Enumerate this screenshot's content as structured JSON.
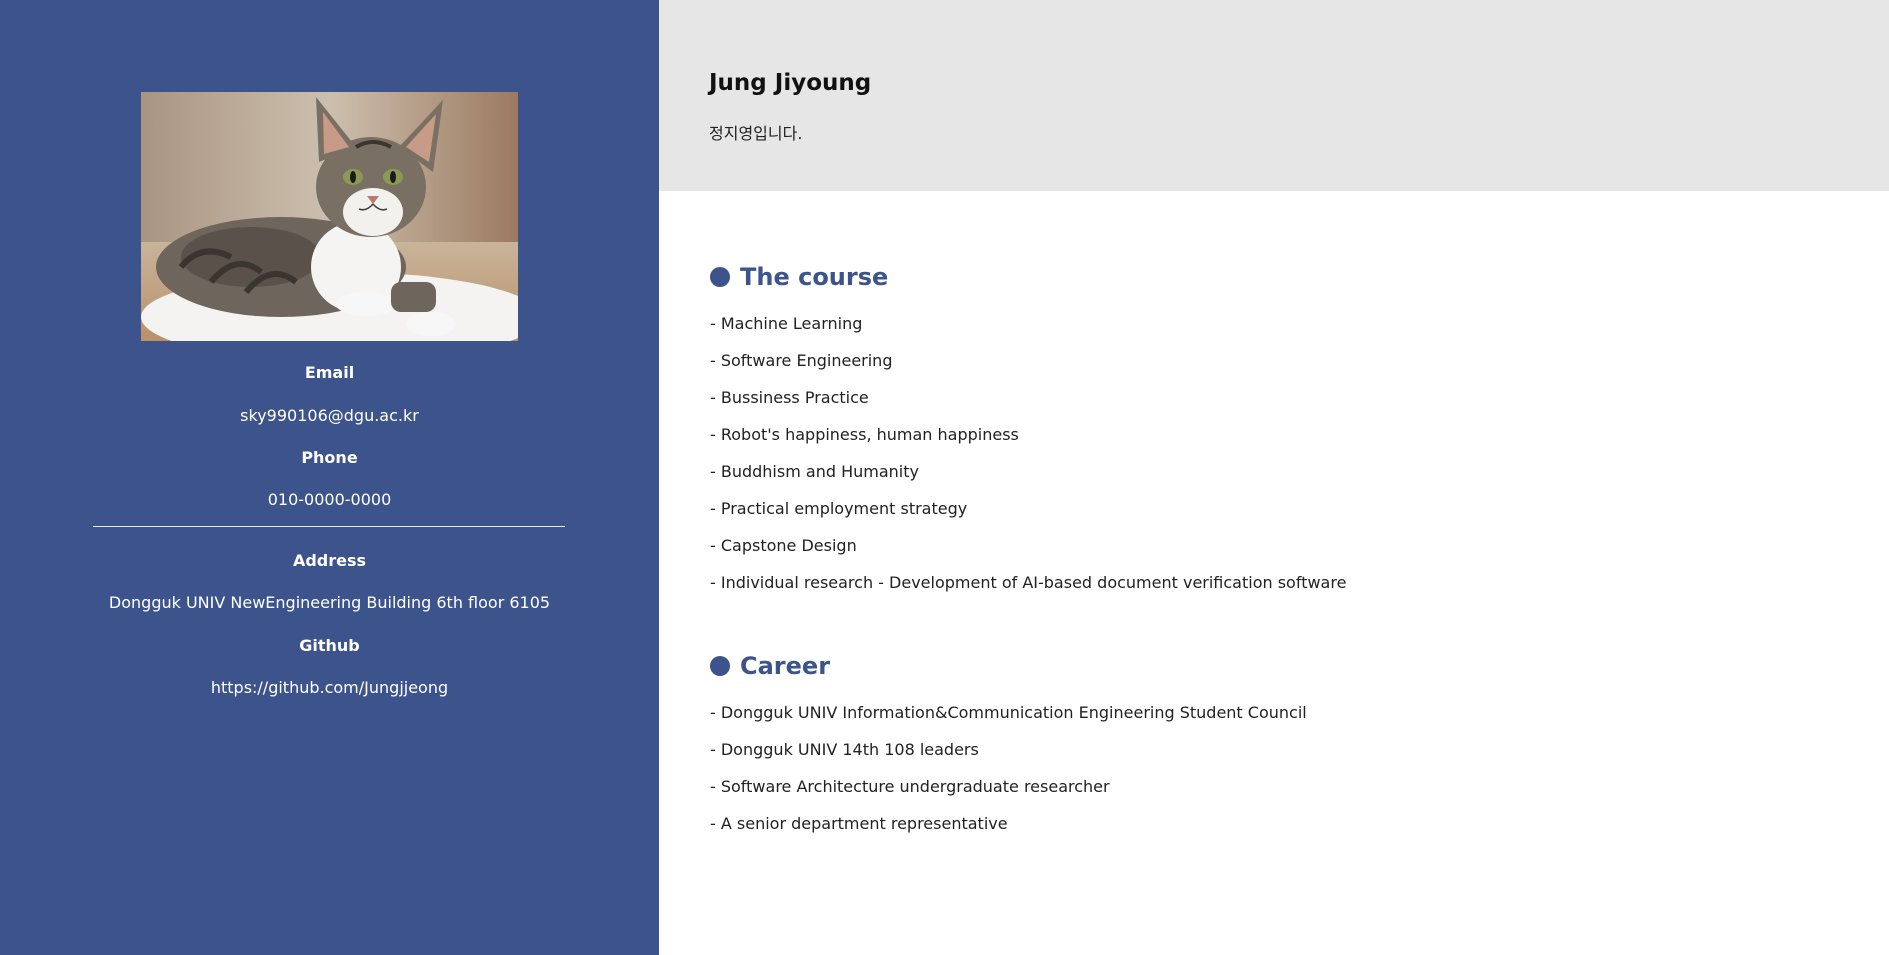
{
  "sidebar": {
    "photo_alt": "cat photo",
    "email_label": "Email",
    "email_value": "sky990106@dgu.ac.kr",
    "phone_label": "Phone",
    "phone_value": "010-0000-0000",
    "address_label": "Address",
    "address_value": "Dongguk UNIV NewEngineering Building 6th floor 6105",
    "github_label": "Github",
    "github_value": "https://github.com/Jungjjeong"
  },
  "header": {
    "name": "Jung Jiyoung",
    "intro": "정지영입니다."
  },
  "course": {
    "title": "The course",
    "items": [
      "- Machine Learning",
      "- Software Engineering",
      "- Bussiness Practice",
      "- Robot's happiness, human happiness",
      "- Buddhism and Humanity",
      "- Practical employment strategy",
      "- Capstone Design",
      "- Individual research - Development of AI-based document verification software"
    ]
  },
  "career": {
    "title": "Career",
    "items": [
      "- Dongguk UNIV Information&Communication Engineering Student Council",
      "- Dongguk UNIV 14th 108 leaders",
      "- Software Architecture undergraduate researcher",
      "- A senior department representative"
    ]
  },
  "colors": {
    "sidebar_bg": "#3c538c",
    "header_bg": "#e6e6e6",
    "accent": "#3c538c"
  }
}
